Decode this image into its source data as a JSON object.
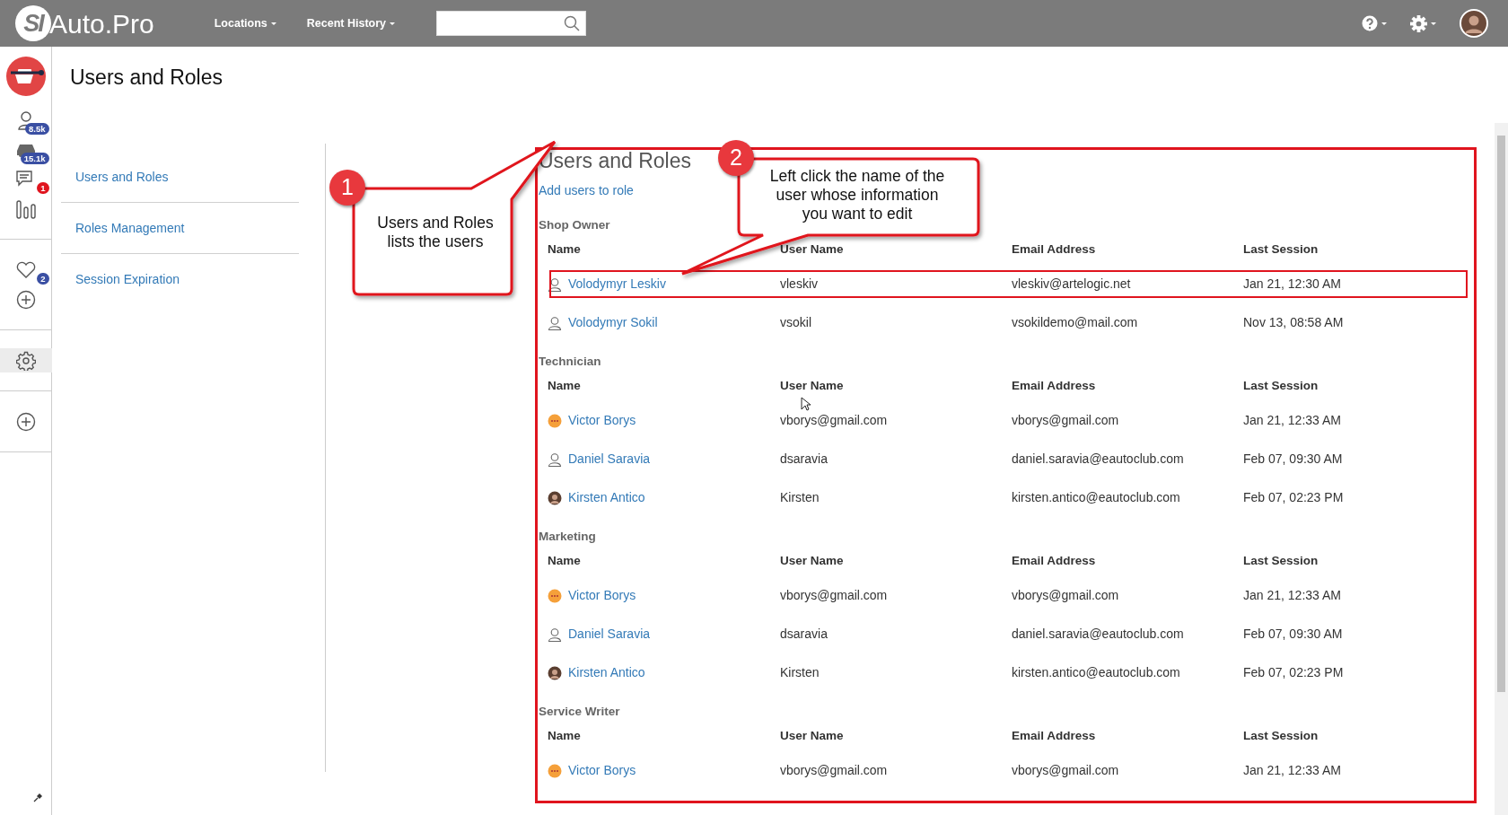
{
  "topbar": {
    "logo_mark": "SI",
    "logo_text": "Auto.Pro",
    "menus": [
      "Locations",
      "Recent History"
    ]
  },
  "rail": {
    "groups": [
      [
        {
          "kind": "logo",
          "selected": false
        },
        {
          "kind": "user",
          "badge": "8.5k",
          "color": "#3a4fa3",
          "selected": false
        },
        {
          "kind": "car",
          "badge": "15.1k",
          "color": "#3a4fa3",
          "selected": false
        },
        {
          "kind": "chat",
          "badge": "1",
          "color": "#e0141e",
          "selected": false
        },
        {
          "kind": "bars",
          "selected": false
        }
      ],
      [
        {
          "kind": "heart",
          "badge": "2",
          "color": "#3a4fa3",
          "selected": false
        },
        {
          "kind": "plus",
          "selected": false
        }
      ],
      [
        {
          "kind": "gear",
          "selected": true
        }
      ],
      [
        {
          "kind": "plus",
          "selected": false
        }
      ]
    ]
  },
  "page_title": "Users and Roles",
  "settings_nav": [
    "Users and Roles",
    "Roles Management",
    "Session Expiration"
  ],
  "section": {
    "title": "Users and Roles",
    "add_link": "Add users to role",
    "outlined": true,
    "roles": [
      {
        "name": "Shop Owner",
        "columns": [
          "Name",
          "User Name",
          "Email Address",
          "Last Session"
        ],
        "rows": [
          {
            "kind": "outline",
            "name": "Volodymyr Leskiv",
            "user_name": "vleskiv",
            "email": "vleskiv@artelogic.net",
            "last_session": "Jan 21, 12:30 AM",
            "outlined": true
          },
          {
            "kind": "outline",
            "name": "Volodymyr Sokil",
            "user_name": "vsokil",
            "email": "vsokildemo@mail.com",
            "last_session": "Nov 13, 08:58 AM",
            "outlined": false
          }
        ]
      },
      {
        "name": "Technician",
        "columns": [
          "Name",
          "User Name",
          "Email Address",
          "Last Session"
        ],
        "rows": [
          {
            "kind": "emoji",
            "name": "Victor Borys",
            "user_name": "vborys@gmail.com",
            "email": "vborys@gmail.com",
            "last_session": "Jan 21, 12:33 AM",
            "outlined": false
          },
          {
            "kind": "outline",
            "name": "Daniel Saravia",
            "user_name": "dsaravia",
            "email": "daniel.saravia@eautoclub.com",
            "last_session": "Feb 07, 09:30 AM",
            "outlined": false
          },
          {
            "kind": "photo",
            "name": "Kirsten Antico",
            "user_name": "Kirsten",
            "email": "kirsten.antico@eautoclub.com",
            "last_session": "Feb 07, 02:23 PM",
            "outlined": false
          }
        ]
      },
      {
        "name": "Marketing",
        "columns": [
          "Name",
          "User Name",
          "Email Address",
          "Last Session"
        ],
        "rows": [
          {
            "kind": "emoji",
            "name": "Victor Borys",
            "user_name": "vborys@gmail.com",
            "email": "vborys@gmail.com",
            "last_session": "Jan 21, 12:33 AM",
            "outlined": false
          },
          {
            "kind": "outline",
            "name": "Daniel Saravia",
            "user_name": "dsaravia",
            "email": "daniel.saravia@eautoclub.com",
            "last_session": "Feb 07, 09:30 AM",
            "outlined": false
          },
          {
            "kind": "photo",
            "name": "Kirsten Antico",
            "user_name": "Kirsten",
            "email": "kirsten.antico@eautoclub.com",
            "last_session": "Feb 07, 02:23 PM",
            "outlined": false
          }
        ]
      },
      {
        "name": "Service Writer",
        "columns": [
          "Name",
          "User Name",
          "Email Address",
          "Last Session"
        ],
        "rows": [
          {
            "kind": "emoji",
            "name": "Victor Borys",
            "user_name": "vborys@gmail.com",
            "email": "vborys@gmail.com",
            "last_session": "Jan 21, 12:33 AM",
            "outlined": false
          }
        ]
      }
    ]
  },
  "callouts": [
    {
      "number": "1",
      "text": "Users and Roles lists the users"
    },
    {
      "number": "2",
      "text": "Left click the name of the user whose information you want to edit"
    }
  ]
}
